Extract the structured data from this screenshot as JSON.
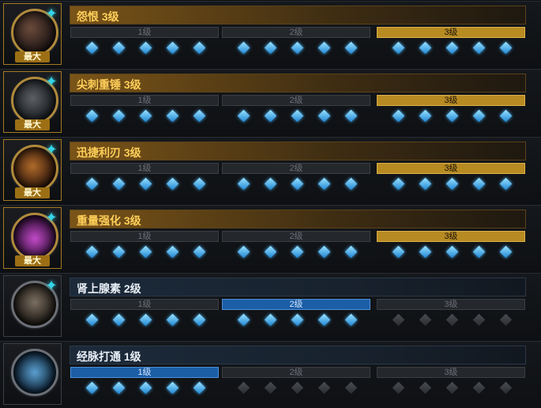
{
  "max_badge": "最大",
  "colors": {
    "gold": "#ffcf5a",
    "active_level_gold": "#b88a22",
    "active_level_blue": "#1c5ea6",
    "gem_on": "#35a9f0",
    "gem_off": "#3a3d42",
    "star": "#35d6e8"
  },
  "level_labels": [
    "1级",
    "2级",
    "3级"
  ],
  "skills": [
    {
      "name": "怨恨 3级",
      "level": 3,
      "max": true
    },
    {
      "name": "尖刺重锤 3级",
      "level": 3,
      "max": true
    },
    {
      "name": "迅捷利刃 3级",
      "level": 3,
      "max": true
    },
    {
      "name": "重量强化 3级",
      "level": 3,
      "max": true
    },
    {
      "name": "肾上腺素 2级",
      "level": 2,
      "max": false
    },
    {
      "name": "经脉打通 1级",
      "level": 1,
      "max": false
    }
  ]
}
